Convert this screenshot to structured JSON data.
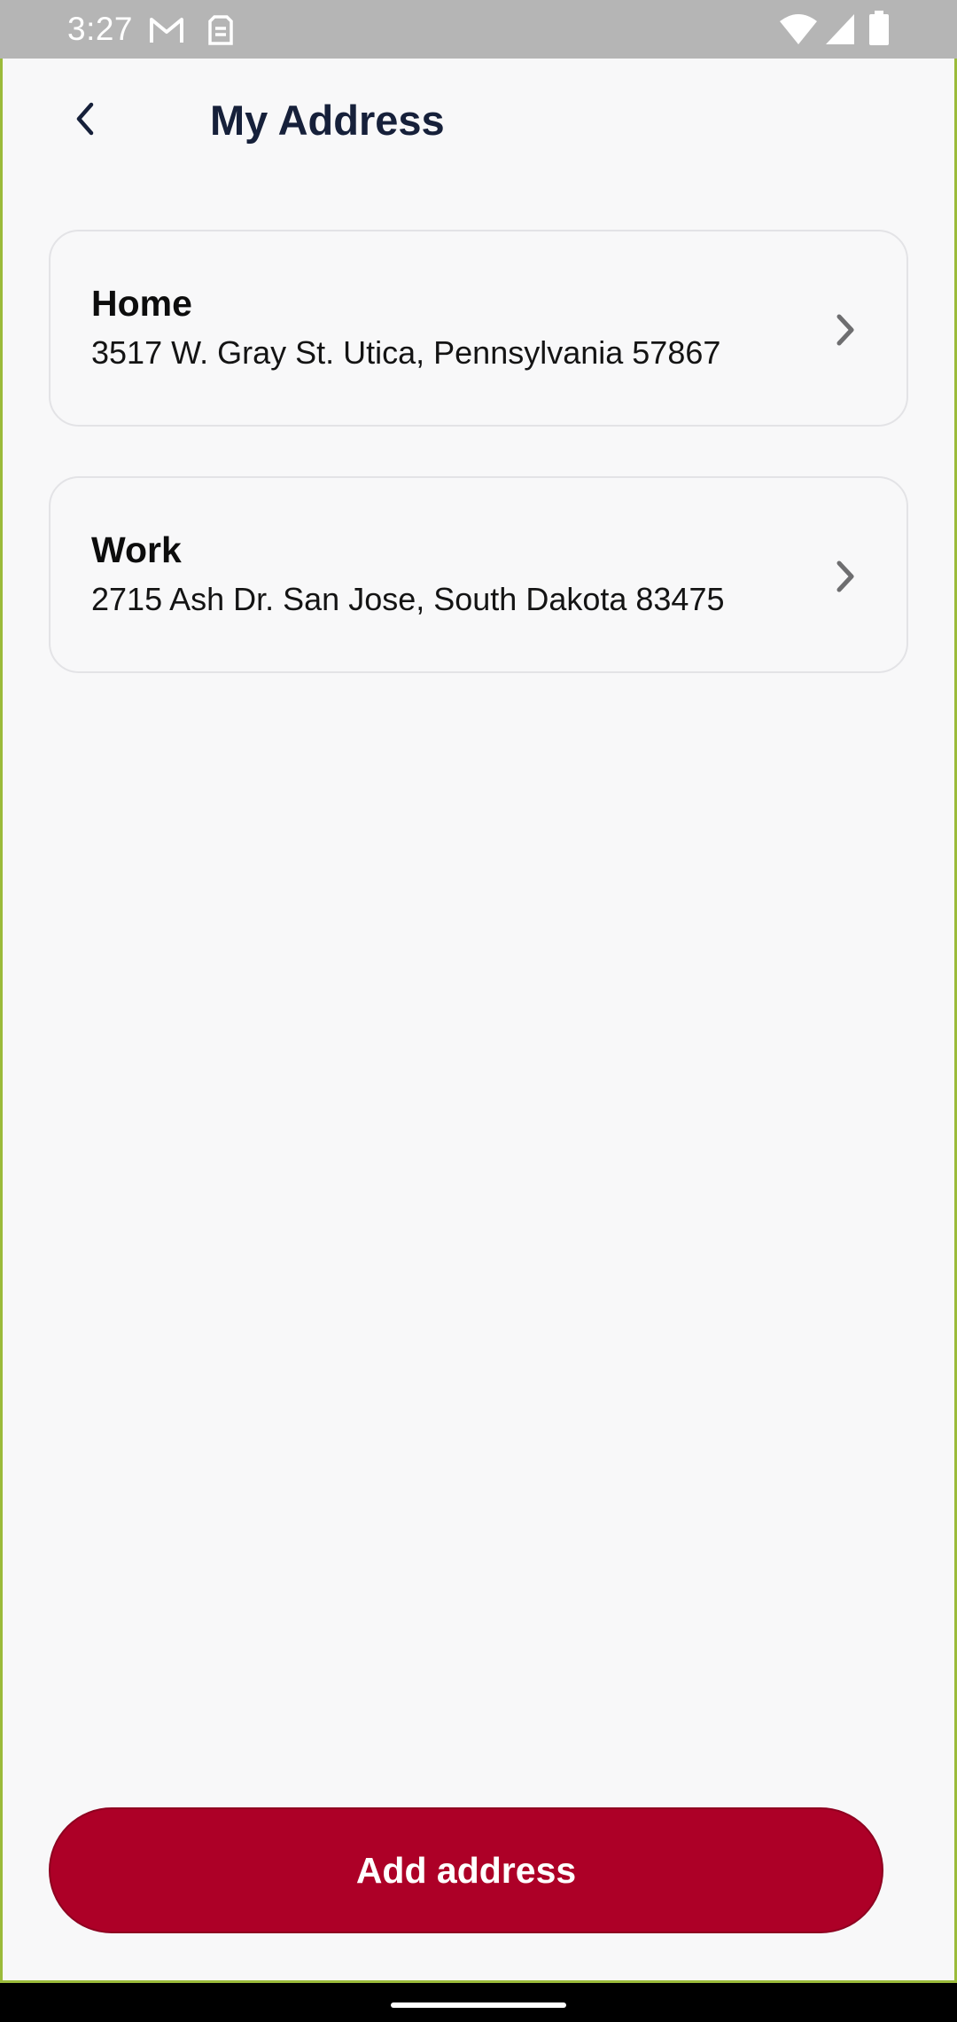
{
  "status_bar": {
    "time": "3:27",
    "icons": [
      "gmail-icon",
      "sim-icon",
      "wifi-icon",
      "signal-icon",
      "battery-icon"
    ]
  },
  "header": {
    "title": "My Address",
    "back_icon": "chevron-left-icon"
  },
  "addresses": [
    {
      "label": "Home",
      "address": "3517 W. Gray St. Utica, Pennsylvania 57867"
    },
    {
      "label": "Work",
      "address": "2715 Ash Dr. San Jose, South Dakota 83475"
    }
  ],
  "actions": {
    "add_address_label": "Add address"
  },
  "colors": {
    "primary": "#ad0027",
    "title_text": "#16203a",
    "background": "#f8f8f9",
    "card_border": "#e3e3e6"
  }
}
